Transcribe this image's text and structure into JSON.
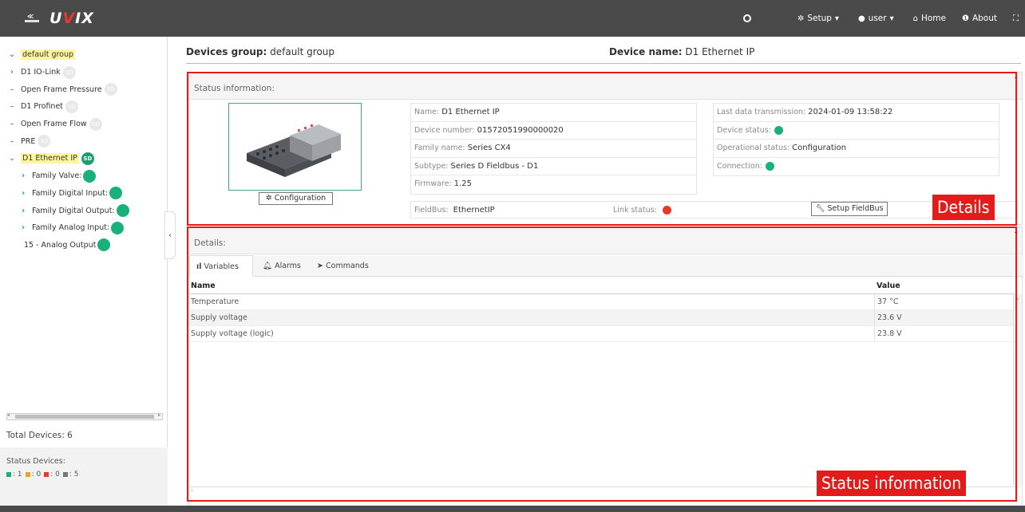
{
  "topbar": {
    "brand_small": "CAMOZZI",
    "brand_letters_1": "U",
    "brand_letters_v": "V",
    "brand_letters_2": "IX",
    "setup": "Setup",
    "user": "user",
    "home": "Home",
    "about": "About"
  },
  "sidebar": {
    "tree": [
      {
        "prefix": "⌄",
        "label": "default group",
        "highlight": true,
        "badge": "",
        "badge_type": "none"
      },
      {
        "prefix": "›",
        "label": "D1 IO-Link",
        "highlight": false,
        "badge": "SD",
        "badge_type": "grey"
      },
      {
        "prefix": "–",
        "label": "Open Frame Pressure",
        "highlight": false,
        "badge": "SD",
        "badge_type": "grey"
      },
      {
        "prefix": "–",
        "label": "D1 Profinet",
        "highlight": false,
        "badge": "SD",
        "badge_type": "grey"
      },
      {
        "prefix": "–",
        "label": "Open Frame Flow",
        "highlight": false,
        "badge": "SD",
        "badge_type": "grey"
      },
      {
        "prefix": "–",
        "label": "PRE",
        "highlight": false,
        "badge": "SD",
        "badge_type": "grey"
      },
      {
        "prefix": "⌄",
        "label": "D1 Ethernet IP",
        "highlight": true,
        "badge": "SD",
        "badge_type": "green"
      }
    ],
    "children": [
      {
        "prefix": "›",
        "label": "Family Valve:"
      },
      {
        "prefix": "›",
        "label": "Family Digital Input:"
      },
      {
        "prefix": "›",
        "label": "Family Digital Output:"
      },
      {
        "prefix": "›",
        "label": "Family Analog Input:"
      },
      {
        "prefix": "",
        "label": "15 - Analog Output"
      }
    ],
    "total_devices": "Total Devices: 6",
    "status_devices_label": "Status Devices:",
    "status_counts": [
      {
        "color": "#1ab07a",
        "count": ": 1"
      },
      {
        "color": "#f0a020",
        "count": ": 0"
      },
      {
        "color": "#e8382c",
        "count": ": 0"
      },
      {
        "color": "#777777",
        "count": ": 5"
      }
    ]
  },
  "main": {
    "devices_group_label": "Devices group:",
    "devices_group_value": "default group",
    "device_name_label": "Device name:",
    "device_name_value": "D1 Ethernet IP",
    "status_panel_title": "Status information:",
    "configuration_button": "Configuration",
    "info_left": [
      {
        "label": "Name:",
        "value": "D1 Ethernet IP"
      },
      {
        "label": "Device number:",
        "value": "01572051990000020"
      },
      {
        "label": "Family name:",
        "value": "Series CX4"
      },
      {
        "label": "Subtype:",
        "value": "Series D Fieldbus - D1"
      },
      {
        "label": "Firmware:",
        "value": "1.25"
      }
    ],
    "info_right": [
      {
        "label": "Last data transmission:",
        "value": "2024-01-09 13:58:22"
      },
      {
        "label": "Device status:",
        "value": ""
      },
      {
        "label": "Operational status:",
        "value": "Configuration"
      },
      {
        "label": "Connection:",
        "value": ""
      }
    ],
    "fieldbus_label": "FieldBus:",
    "fieldbus_value": "EthernetIP",
    "link_status_label": "Link status:",
    "setup_fieldbus_button": "Setup FieldBus",
    "details_panel_title": "Details:",
    "tabs": [
      "Variables",
      "Alarms",
      "Commands"
    ],
    "table_headers": {
      "name": "Name",
      "value": "Value"
    },
    "table_rows": [
      {
        "name": "Temperature",
        "value": "37 °C"
      },
      {
        "name": "Supply voltage",
        "value": "23.6 V"
      },
      {
        "name": "Supply voltage (logic)",
        "value": "23.8 V"
      }
    ]
  },
  "annotations": {
    "details_label": "Details",
    "status_label": "Status information"
  },
  "colors": {
    "accent_green": "#1ab07a",
    "status_red": "#e8382c",
    "annotation_red": "#e41b1b",
    "navbar": "#4a4a4a"
  }
}
